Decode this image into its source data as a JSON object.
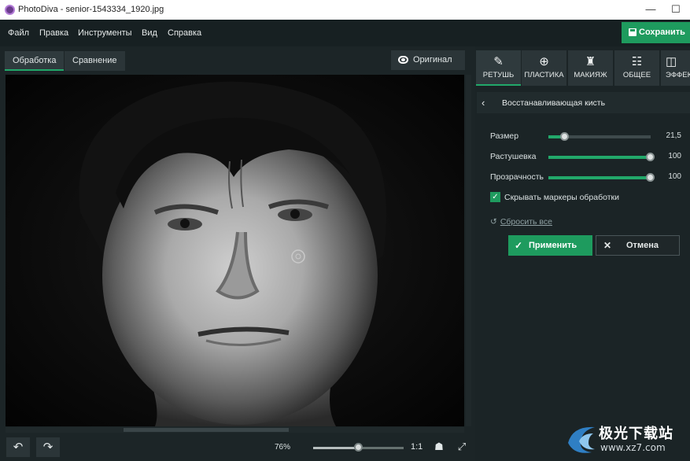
{
  "window": {
    "title": "PhotoDiva - senior-1543334_1920.jpg",
    "minimize_glyph": "—",
    "maximize_glyph": "☐"
  },
  "menu": [
    "Файл",
    "Правка",
    "Инструменты",
    "Вид",
    "Справка"
  ],
  "save_button": {
    "label": "Сохранить"
  },
  "view_tabs": [
    {
      "label": "Обработка",
      "active": true
    },
    {
      "label": "Сравнение",
      "active": false
    }
  ],
  "original_button": {
    "label": "Оригинал",
    "icon": "eye-icon"
  },
  "zoom": {
    "label": "76%",
    "value": 0.5,
    "one_to_one": "1:1"
  },
  "panel_tabs": [
    {
      "label": "РЕТУШЬ",
      "icon": "retouch-brush-icon",
      "active": true
    },
    {
      "label": "ПЛАСТИКА",
      "icon": "liquify-icon",
      "active": false
    },
    {
      "label": "МАКИЯЖ",
      "icon": "makeup-icon",
      "active": false
    },
    {
      "label": "ОБЩЕЕ",
      "icon": "sliders-icon",
      "active": false
    },
    {
      "label": "ЭФФЕКТЫ",
      "icon": "effects-icon",
      "active": false
    }
  ],
  "panel": {
    "title": "Восстанавливающая кисть",
    "sliders": [
      {
        "label": "Размер",
        "value": "21,5",
        "fraction": 0.16
      },
      {
        "label": "Растушевка",
        "value": "100",
        "fraction": 1.0
      },
      {
        "label": "Прозрачность",
        "value": "100",
        "fraction": 1.0
      }
    ],
    "hide_markers": {
      "label": "Скрывать маркеры обработки",
      "checked": true
    },
    "reset_label": "Сбросить все",
    "apply_label": "Применить",
    "cancel_label": "Отмена"
  },
  "watermark": {
    "text": "极光下载站",
    "url": "www.xz7.com"
  },
  "colors": {
    "accent": "#1e9b5e",
    "background": "#1c2527",
    "panel": "#1b2426"
  }
}
